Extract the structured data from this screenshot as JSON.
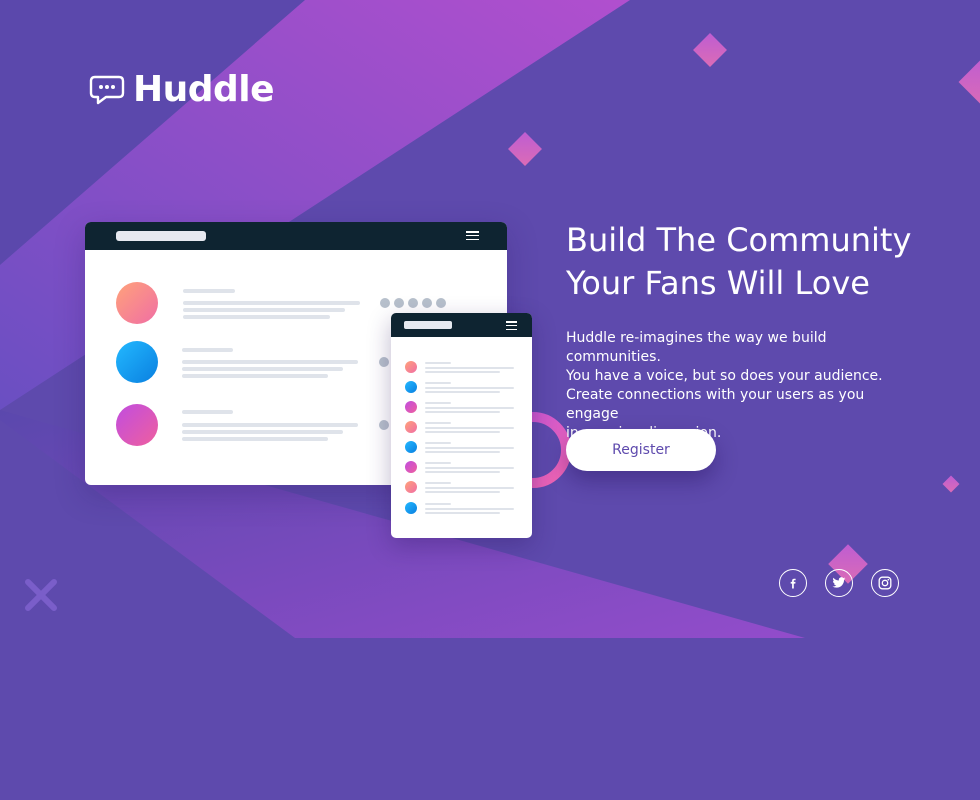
{
  "brand": {
    "name": "Huddle",
    "logo_icon": "chat-bubble-icon"
  },
  "hero": {
    "headline_line1": "Build The Community",
    "headline_line2": "Your Fans Will Love",
    "description_line1": "Huddle re-imagines the way we build communities.",
    "description_line2": "You have a voice, but so does your audience.",
    "description_line3": "Create connections with your users as you engage",
    "description_line4": "in genuine discussion.",
    "cta_label": "Register"
  },
  "social": [
    {
      "icon": "facebook-icon"
    },
    {
      "icon": "twitter-icon"
    },
    {
      "icon": "instagram-icon"
    }
  ],
  "colors": {
    "background": "#5e4aad",
    "accent_pink": "#df57c1",
    "mock_header": "#0e2431",
    "cta_text": "#5e4aad"
  }
}
